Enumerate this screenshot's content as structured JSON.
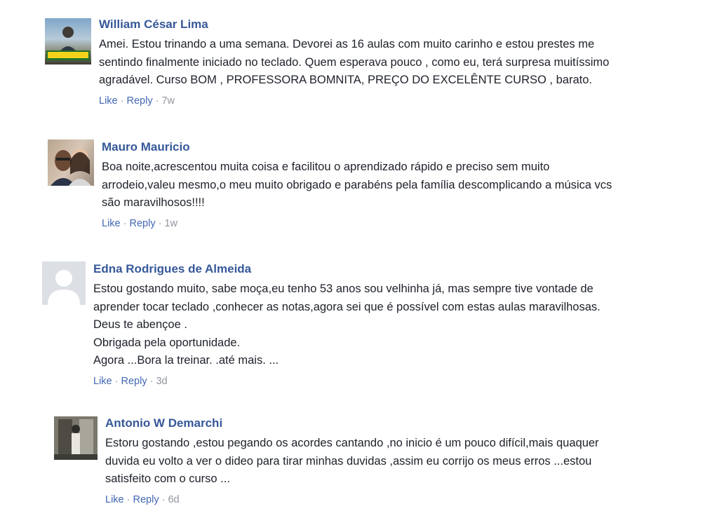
{
  "comments": [
    {
      "author": "William César Lima",
      "avatar_icon": "user-photo-icon",
      "lines": [
        "Amei. Estou trinando a uma semana. Devorei as 16 aulas com muito carinho e estou prestes me",
        "sentindo finalmente iniciado no teclado. Quem esperava pouco , como eu, terá surpresa muitíssimo",
        "agradável. Curso BOM , PROFESSORA BOMNITA, PREÇO DO EXCELÊNTE CURSO , barato."
      ],
      "like": "Like",
      "reply": "Reply",
      "sep": "·",
      "time": "7w"
    },
    {
      "author": "Mauro Mauricio",
      "avatar_icon": "user-photo-icon",
      "lines": [
        "Boa noite,acrescentou muita coisa e facilitou o aprendizado rápido e preciso sem muito",
        "arrodeio,valeu mesmo,o meu muito obrigado e parabéns pela família descomplicando a música vcs",
        "são maravilhosos!!!!"
      ],
      "like": "Like",
      "reply": "Reply",
      "sep": "·",
      "time": "1w"
    },
    {
      "author": "Edna Rodrigues de Almeida",
      "avatar_icon": "default-avatar-icon",
      "lines": [
        "Estou gostando muito, sabe moça,eu tenho 53 anos sou velhinha já, mas sempre tive vontade de",
        "aprender tocar teclado ,conhecer as notas,agora sei que é possível com estas aulas maravilhosas.",
        "Deus te abençoe .",
        "Obrigada pela oportunidade.",
        "Agora ...Bora la treinar. .até mais. ..."
      ],
      "like": "Like",
      "reply": "Reply",
      "sep": "·",
      "time": "3d"
    },
    {
      "author": "Antonio W Demarchi",
      "avatar_icon": "user-photo-icon",
      "lines": [
        "Estoru gostando ,estou pegando os acordes cantando ,no inicio é um pouco difícil,mais quaquer",
        "duvida eu volto a ver o dideo para tirar minhas duvidas ,assim eu corrijo os meus erros ...estou",
        "satisfeito com o curso ..."
      ],
      "like": "Like",
      "reply": "Reply",
      "sep": "·",
      "time": "6d"
    }
  ],
  "colors": {
    "author": "#365899",
    "link": "#4267b2",
    "meta": "#90949c",
    "text": "#1d2129"
  }
}
